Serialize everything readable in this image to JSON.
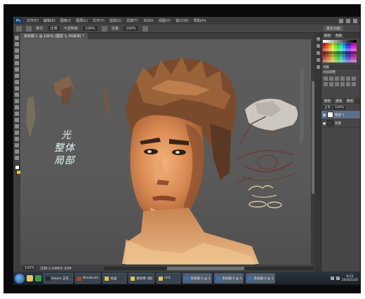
{
  "menubar": {
    "logo": "Ps",
    "items": [
      "文件(F)",
      "编辑(E)",
      "图像(I)",
      "图层(L)",
      "文字(Y)",
      "选择(S)",
      "滤镜(T)",
      "3D(D)",
      "视图(V)",
      "窗口(W)",
      "帮助(H)"
    ]
  },
  "options": {
    "mode_label": "模式:",
    "mode_value": "正常",
    "opacity_label": "不透明度:",
    "opacity_value": "100%",
    "flow_label": "流量:",
    "flow_value": "100%",
    "workspace": "基本功能"
  },
  "document": {
    "tab_title": "未标题-1 @ 100% (图层 1, RGB/8) *"
  },
  "status": {
    "zoom": "100%",
    "doc_size": "文档:2.64M/5.32M"
  },
  "panels": {
    "swatch_tabs": [
      "颜色",
      "色板"
    ],
    "adjust_tab": "调整",
    "adjust_label": "添加调整",
    "layer_tabs": [
      "图层",
      "通道",
      "路径"
    ],
    "layer_mode": "正常",
    "layer_opacity": "100%",
    "layers": [
      {
        "name": "图层 1",
        "selected": true
      },
      {
        "name": "背景",
        "selected": false
      }
    ]
  },
  "canvas": {
    "annotation_lines": [
      "光",
      "整体",
      "局部"
    ]
  },
  "taskbar": {
    "tasks": [
      {
        "label": "Steam 正在...",
        "color": "#1b2838"
      },
      {
        "label": "Bandicam",
        "color": "#c0392b"
      },
      {
        "label": "绘画",
        "color": "#e8c04a"
      },
      {
        "label": "素材库 (图)",
        "color": "#e8c04a"
      },
      {
        "label": "ch3",
        "color": "#e8c04a"
      },
      {
        "label": "未标题-1 @ 1...",
        "color": "#2a74c9"
      },
      {
        "label": "未标题-2 @ 1...",
        "color": "#2a74c9"
      },
      {
        "label": "未标题-3 @ 1...",
        "color": "#2a74c9"
      }
    ],
    "time": "9:23",
    "date": "2016/1/20"
  },
  "colors": {
    "accent": "#5c6f86",
    "foreground": "#ffffff",
    "background": "#e8b84a"
  }
}
